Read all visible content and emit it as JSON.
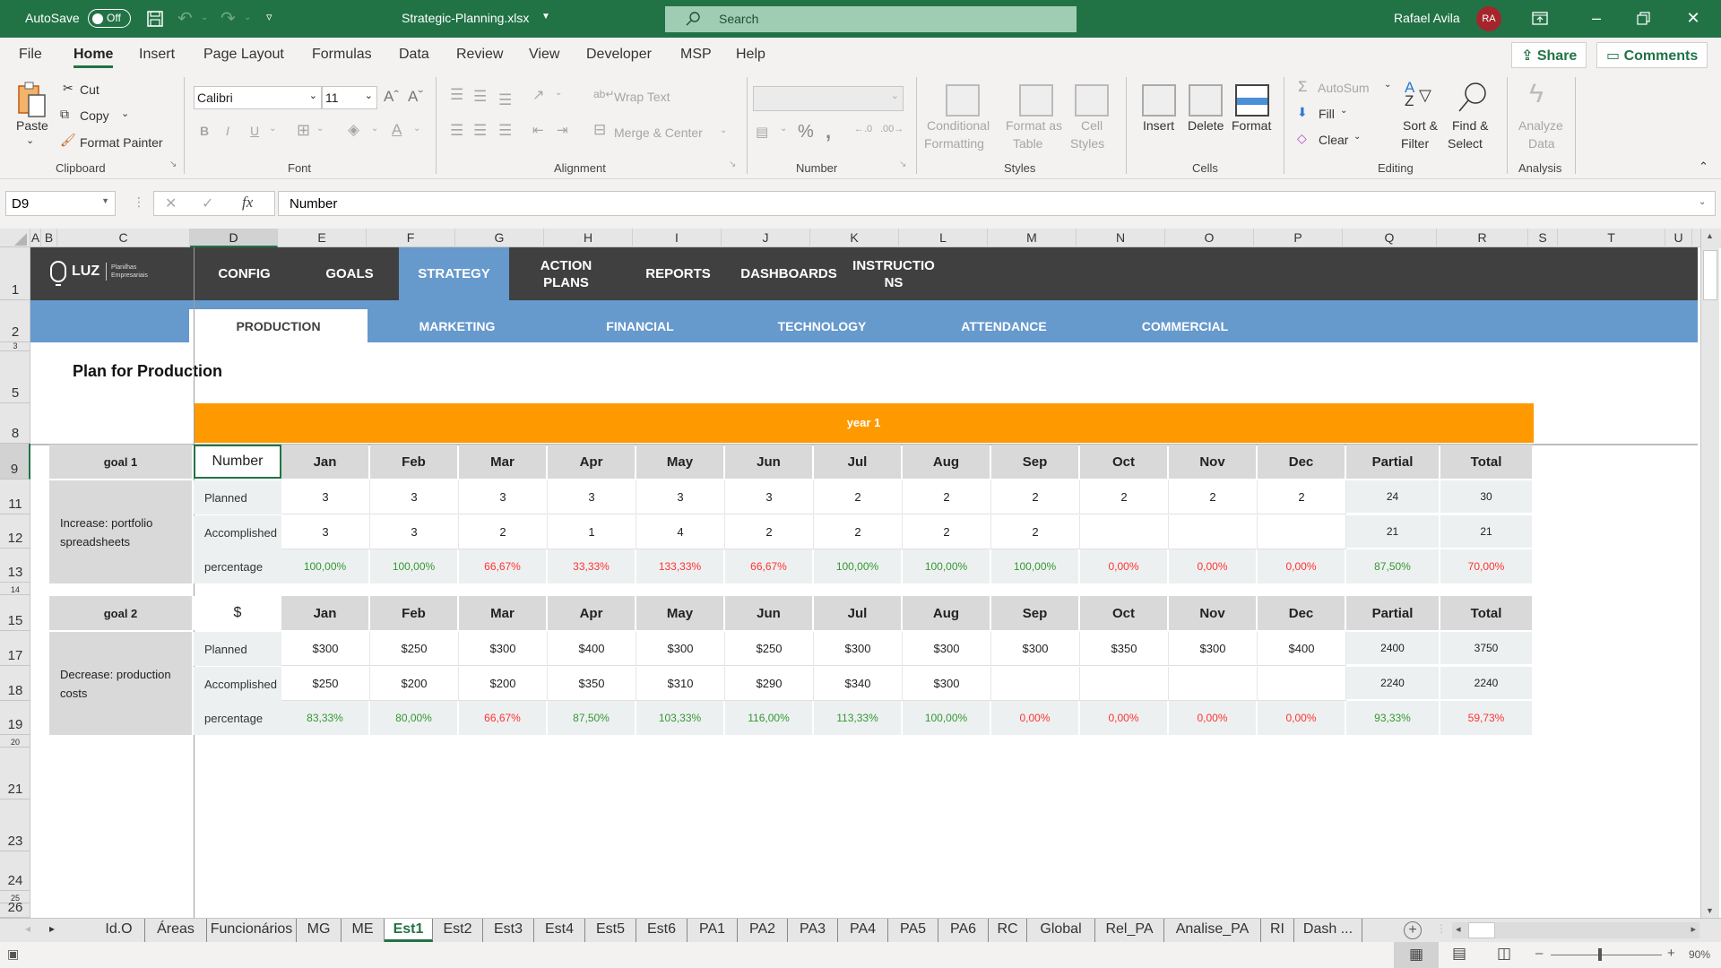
{
  "titlebar": {
    "autosave_label": "AutoSave",
    "autosave_state": "Off",
    "filename": "Strategic-Planning.xlsx",
    "search_placeholder": "Search",
    "user_name": "Rafael Avila",
    "user_initials": "RA"
  },
  "menu": {
    "tabs": [
      "File",
      "Home",
      "Insert",
      "Page Layout",
      "Formulas",
      "Data",
      "Review",
      "View",
      "Developer",
      "MSP",
      "Help"
    ],
    "active": "Home",
    "share_label": "Share",
    "comments_label": "Comments"
  },
  "ribbon": {
    "clipboard": {
      "paste": "Paste",
      "cut": "Cut",
      "copy": "Copy",
      "format_painter": "Format Painter",
      "group": "Clipboard"
    },
    "font": {
      "name": "Calibri",
      "size": "11",
      "group": "Font",
      "bold": "B",
      "italic": "I",
      "underline": "U"
    },
    "alignment": {
      "wrap_text": "Wrap Text",
      "merge_center": "Merge & Center",
      "group": "Alignment"
    },
    "number": {
      "format_value": "",
      "percent": "%",
      "comma": ",",
      "group": "Number"
    },
    "styles": {
      "conditional_1": "Conditional",
      "conditional_2": "Formatting",
      "format_table_1": "Format as",
      "format_table_2": "Table",
      "cell_styles_1": "Cell",
      "cell_styles_2": "Styles",
      "group": "Styles"
    },
    "cells": {
      "insert": "Insert",
      "delete": "Delete",
      "format": "Format",
      "group": "Cells"
    },
    "editing": {
      "autosum": "AutoSum",
      "fill": "Fill",
      "clear": "Clear",
      "sort_1": "Sort &",
      "sort_2": "Filter",
      "find_1": "Find &",
      "find_2": "Select",
      "group": "Editing"
    },
    "analysis": {
      "analyze_1": "Analyze",
      "analyze_2": "Data",
      "group": "Analysis"
    }
  },
  "formula_bar": {
    "name_box": "D9",
    "formula": "Number"
  },
  "grid": {
    "columns": [
      "A",
      "B",
      "C",
      "D",
      "E",
      "F",
      "G",
      "H",
      "I",
      "J",
      "K",
      "L",
      "M",
      "N",
      "O",
      "P",
      "Q",
      "R",
      "S",
      "T",
      "U"
    ],
    "selected_column": "D",
    "rows": [
      "1",
      "2",
      "3",
      "5",
      "8",
      "9",
      "11",
      "12",
      "13",
      "14",
      "15",
      "17",
      "18",
      "19",
      "20",
      "21",
      "23",
      "24",
      "25",
      "26"
    ],
    "selected_row": "9"
  },
  "sheet": {
    "logo": {
      "brand": "LUZ",
      "tagline_1": "Planilhas",
      "tagline_2": "Empresariais"
    },
    "nav": [
      "CONFIG",
      "GOALS",
      "STRATEGY",
      "ACTION PLANS",
      "REPORTS",
      "DASHBOARDS",
      "INSTRUCTIONS"
    ],
    "nav_active": "STRATEGY",
    "subnav": [
      "PRODUCTION",
      "MARKETING",
      "FINANCIAL",
      "TECHNOLOGY",
      "ATTENDANCE",
      "COMMERCIAL"
    ],
    "subnav_active": "PRODUCTION",
    "page_title": "Plan for Production",
    "year_label": "year 1",
    "month_headers": [
      "Jan",
      "Feb",
      "Mar",
      "Apr",
      "May",
      "Jun",
      "Jul",
      "Aug",
      "Sep",
      "Oct",
      "Nov",
      "Dec"
    ],
    "partial_label": "Partial",
    "total_label": "Total",
    "row_labels": {
      "planned": "Planned",
      "accomplished": "Accomplished",
      "percentage": "percentage"
    },
    "goals": [
      {
        "name": "goal 1",
        "unit": "Number",
        "description": "Increase: portfolio spreadsheets",
        "planned": [
          "3",
          "3",
          "3",
          "3",
          "3",
          "3",
          "2",
          "2",
          "2",
          "2",
          "2",
          "2"
        ],
        "planned_partial": "24",
        "planned_total": "30",
        "accomplished": [
          "3",
          "3",
          "2",
          "1",
          "4",
          "2",
          "2",
          "2",
          "2",
          "",
          "",
          ""
        ],
        "accomplished_partial": "21",
        "accomplished_total": "21",
        "percentage": [
          {
            "v": "100,00%",
            "s": "green"
          },
          {
            "v": "100,00%",
            "s": "green"
          },
          {
            "v": "66,67%",
            "s": "red"
          },
          {
            "v": "33,33%",
            "s": "red"
          },
          {
            "v": "133,33%",
            "s": "red"
          },
          {
            "v": "66,67%",
            "s": "red"
          },
          {
            "v": "100,00%",
            "s": "green"
          },
          {
            "v": "100,00%",
            "s": "green"
          },
          {
            "v": "100,00%",
            "s": "green"
          },
          {
            "v": "0,00%",
            "s": "red"
          },
          {
            "v": "0,00%",
            "s": "red"
          },
          {
            "v": "0,00%",
            "s": "red"
          }
        ],
        "percentage_partial": {
          "v": "87,50%",
          "s": "green"
        },
        "percentage_total": {
          "v": "70,00%",
          "s": "red"
        }
      },
      {
        "name": "goal 2",
        "unit": "$",
        "description": "Decrease: production costs",
        "planned": [
          "$300",
          "$250",
          "$300",
          "$400",
          "$300",
          "$250",
          "$300",
          "$300",
          "$300",
          "$350",
          "$300",
          "$400"
        ],
        "planned_partial": "2400",
        "planned_total": "3750",
        "accomplished": [
          "$250",
          "$200",
          "$200",
          "$350",
          "$310",
          "$290",
          "$340",
          "$300",
          "",
          "",
          "",
          ""
        ],
        "accomplished_partial": "2240",
        "accomplished_total": "2240",
        "percentage": [
          {
            "v": "83,33%",
            "s": "green"
          },
          {
            "v": "80,00%",
            "s": "green"
          },
          {
            "v": "66,67%",
            "s": "red"
          },
          {
            "v": "87,50%",
            "s": "green"
          },
          {
            "v": "103,33%",
            "s": "green"
          },
          {
            "v": "116,00%",
            "s": "green"
          },
          {
            "v": "113,33%",
            "s": "green"
          },
          {
            "v": "100,00%",
            "s": "green"
          },
          {
            "v": "0,00%",
            "s": "red"
          },
          {
            "v": "0,00%",
            "s": "red"
          },
          {
            "v": "0,00%",
            "s": "red"
          },
          {
            "v": "0,00%",
            "s": "red"
          }
        ],
        "percentage_partial": {
          "v": "93,33%",
          "s": "green"
        },
        "percentage_total": {
          "v": "59,73%",
          "s": "red"
        }
      }
    ]
  },
  "sheet_tabs": {
    "tabs": [
      "Id.O",
      "Áreas",
      "Funcionários",
      "MG",
      "ME",
      "Est1",
      "Est2",
      "Est3",
      "Est4",
      "Est5",
      "Est6",
      "PA1",
      "PA2",
      "PA3",
      "PA4",
      "PA5",
      "PA6",
      "RC",
      "Global",
      "Rel_PA",
      "Analise_PA",
      "RI",
      "Dash ..."
    ],
    "active": "Est1"
  },
  "status": {
    "zoom": "90%",
    "zoom_fraction": 0.9
  },
  "colors": {
    "excel_green": "#217346",
    "nav_dark": "#404040",
    "nav_blue": "#6699cc",
    "year_orange": "#ff9900",
    "good": "#339933",
    "bad": "#ff3333"
  }
}
